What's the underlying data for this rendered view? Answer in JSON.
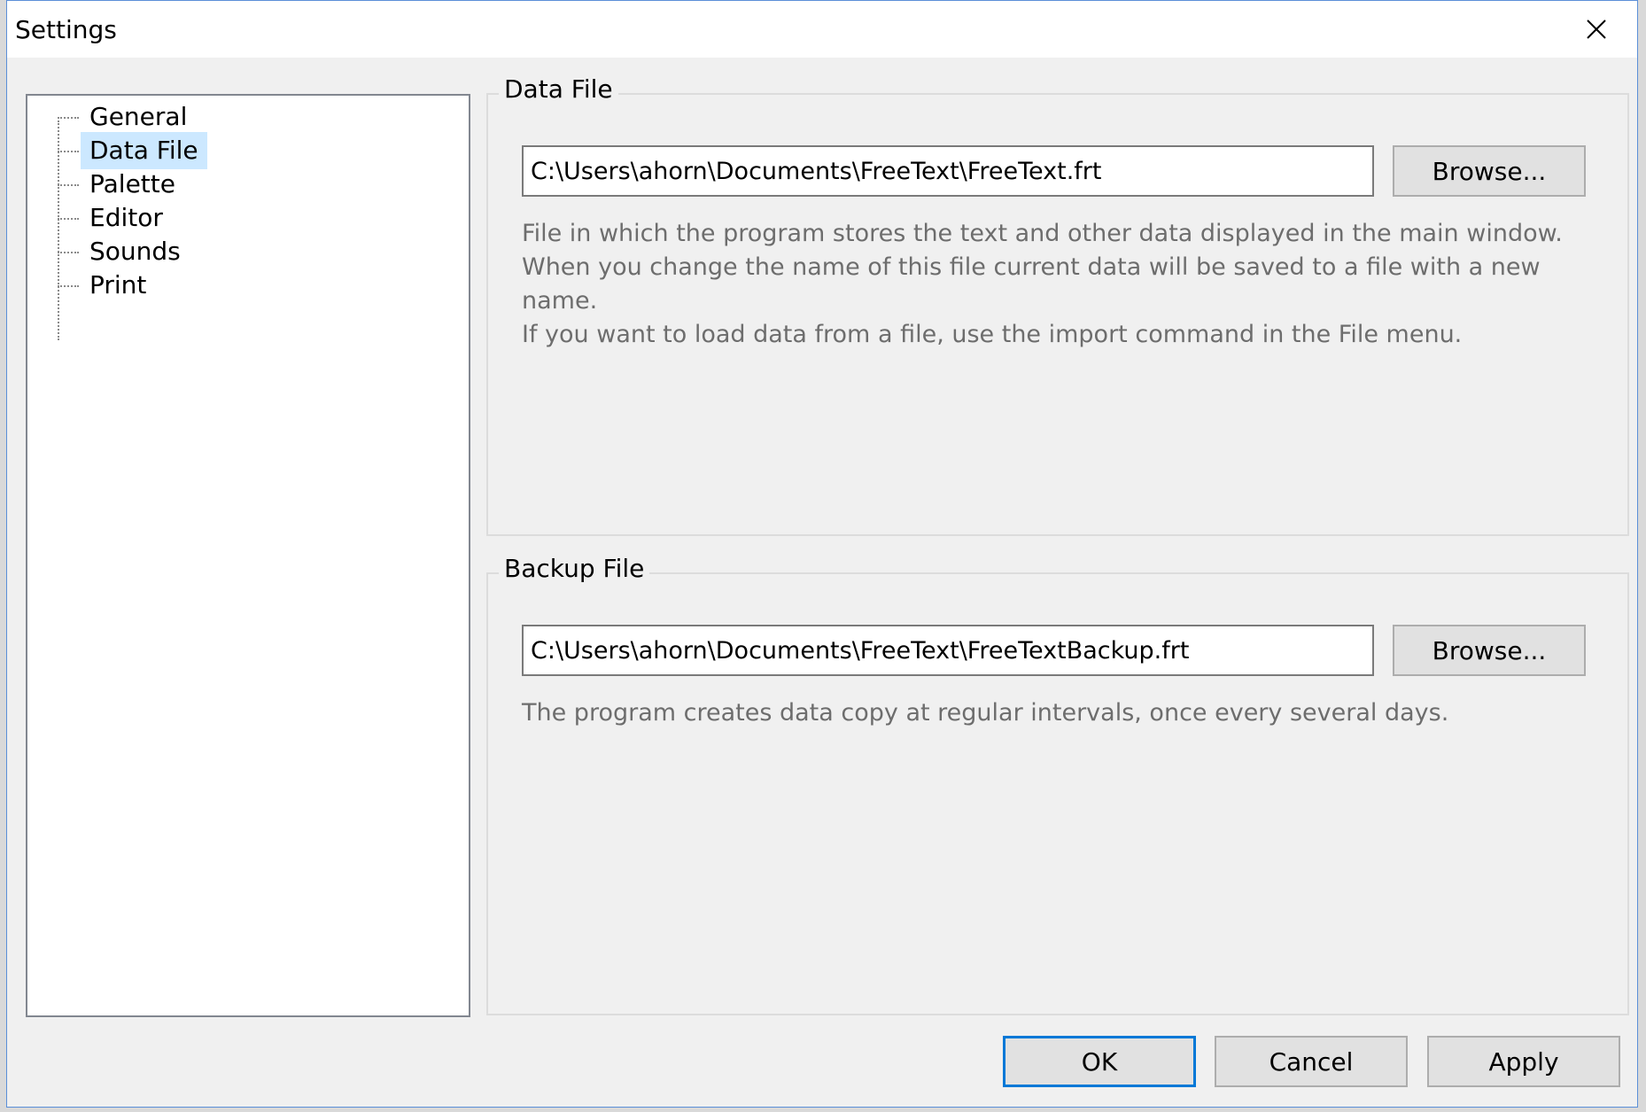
{
  "window": {
    "title": "Settings",
    "close_glyph": "✕"
  },
  "tree": {
    "items": [
      {
        "label": "General",
        "selected": false
      },
      {
        "label": "Data File",
        "selected": true
      },
      {
        "label": "Palette",
        "selected": false
      },
      {
        "label": "Editor",
        "selected": false
      },
      {
        "label": "Sounds",
        "selected": false
      },
      {
        "label": "Print",
        "selected": false
      }
    ]
  },
  "data_file": {
    "legend": "Data File",
    "path": "C:\\Users\\ahorn\\Documents\\FreeText\\FreeText.frt",
    "browse_label": "Browse...",
    "description": "File in which the program stores the text and other data displayed in the main window.\nWhen you change the name of this file current data will be saved to a file with a new name.\nIf you want to load data from a file, use the import command in the File menu."
  },
  "backup_file": {
    "legend": "Backup File",
    "path": "C:\\Users\\ahorn\\Documents\\FreeText\\FreeTextBackup.frt",
    "browse_label": "Browse...",
    "description": "The program creates data copy at regular intervals, once every several days."
  },
  "buttons": {
    "ok": "OK",
    "cancel": "Cancel",
    "apply": "Apply"
  },
  "colors": {
    "selection": "#cce8ff",
    "default_button_border": "#0078d7",
    "window_background": "#f0f0f0"
  }
}
